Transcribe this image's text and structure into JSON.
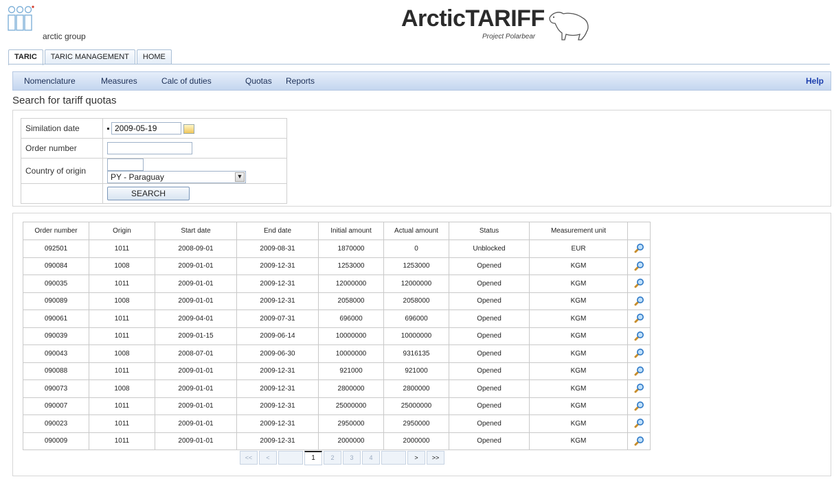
{
  "header": {
    "logo_text": "arctic group",
    "brand_title": "ArcticTARIFF",
    "brand_subtitle": "Project Polarbear"
  },
  "tabs": [
    {
      "label": "TARIC",
      "active": true
    },
    {
      "label": "TARIC MANAGEMENT",
      "active": false
    },
    {
      "label": "HOME",
      "active": false
    }
  ],
  "menu": {
    "items": [
      "Nomenclature",
      "Measures",
      "Calc of duties",
      "Quotas",
      "Reports"
    ],
    "help": "Help"
  },
  "page_title": "Search for tariff quotas",
  "search_form": {
    "simulation_date_label": "Similation date",
    "simulation_date_value": "2009-05-19",
    "order_number_label": "Order number",
    "order_number_value": "",
    "country_label": "Country of origin",
    "country_code_value": "",
    "country_selected": "PY - Paraguay",
    "search_button": "SEARCH"
  },
  "results": {
    "columns": [
      "Order number",
      "Origin",
      "Start date",
      "End date",
      "Initial amount",
      "Actual amount",
      "Status",
      "Measurement unit"
    ],
    "rows": [
      [
        "092501",
        "1011",
        "2008-09-01",
        "2009-08-31",
        "1870000",
        "0",
        "Unblocked",
        "EUR"
      ],
      [
        "090084",
        "1008",
        "2009-01-01",
        "2009-12-31",
        "1253000",
        "1253000",
        "Opened",
        "KGM"
      ],
      [
        "090035",
        "1011",
        "2009-01-01",
        "2009-12-31",
        "12000000",
        "12000000",
        "Opened",
        "KGM"
      ],
      [
        "090089",
        "1008",
        "2009-01-01",
        "2009-12-31",
        "2058000",
        "2058000",
        "Opened",
        "KGM"
      ],
      [
        "090061",
        "1011",
        "2009-04-01",
        "2009-07-31",
        "696000",
        "696000",
        "Opened",
        "KGM"
      ],
      [
        "090039",
        "1011",
        "2009-01-15",
        "2009-06-14",
        "10000000",
        "10000000",
        "Opened",
        "KGM"
      ],
      [
        "090043",
        "1008",
        "2008-07-01",
        "2009-06-30",
        "10000000",
        "9316135",
        "Opened",
        "KGM"
      ],
      [
        "090088",
        "1011",
        "2009-01-01",
        "2009-12-31",
        "921000",
        "921000",
        "Opened",
        "KGM"
      ],
      [
        "090073",
        "1008",
        "2009-01-01",
        "2009-12-31",
        "2800000",
        "2800000",
        "Opened",
        "KGM"
      ],
      [
        "090007",
        "1011",
        "2009-01-01",
        "2009-12-31",
        "25000000",
        "25000000",
        "Opened",
        "KGM"
      ],
      [
        "090023",
        "1011",
        "2009-01-01",
        "2009-12-31",
        "2950000",
        "2950000",
        "Opened",
        "KGM"
      ],
      [
        "090009",
        "1011",
        "2009-01-01",
        "2009-12-31",
        "2000000",
        "2000000",
        "Opened",
        "KGM"
      ]
    ],
    "row_action_icon": "magnifier-icon"
  },
  "pager": {
    "first": "<<",
    "prev": "<",
    "pages": [
      "1",
      "2",
      "3",
      "4"
    ],
    "current_page": "1",
    "next": ">",
    "last": ">>"
  }
}
